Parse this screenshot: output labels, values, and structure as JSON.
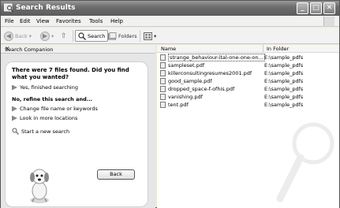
{
  "window": {
    "title": "Search Results",
    "controls": [
      "_",
      "□",
      "✕"
    ]
  },
  "menu": [
    "File",
    "Edit",
    "View",
    "Favorites",
    "Tools",
    "Help"
  ],
  "toolbar": {
    "back": "Back",
    "search": "Search",
    "folders": "Folders"
  },
  "companion": {
    "header": "Search Companion",
    "close": "×",
    "question": "There were 7 files found. Did you find what you wanted?",
    "yes_option": "Yes, finished searching",
    "refine_heading": "No, refine this search and...",
    "options": [
      "Change file name or keywords",
      "Look in more locations"
    ],
    "new_search": "Start a new search",
    "back_button": "Back"
  },
  "results": {
    "columns": [
      "Name",
      "In Folder"
    ],
    "rows": [
      {
        "name": "strange_behaviour-ital-one-one-on...",
        "folder": "E:\\sample_pdfs"
      },
      {
        "name": "sampleset.pdf",
        "folder": "E:\\sample_pdfs"
      },
      {
        "name": "killerconsultingresumes2001.pdf",
        "folder": "E:\\sample_pdfs"
      },
      {
        "name": "good_sample.pdf",
        "folder": "E:\\sample_pdfs"
      },
      {
        "name": "dropped_space-f-ofhis.pdf",
        "folder": "E:\\sample_pdfs"
      },
      {
        "name": "vanishing.pdf",
        "folder": "E:\\sample_pdfs"
      },
      {
        "name": "tent.pdf",
        "folder": "E:\\sample_pdfs"
      }
    ]
  }
}
